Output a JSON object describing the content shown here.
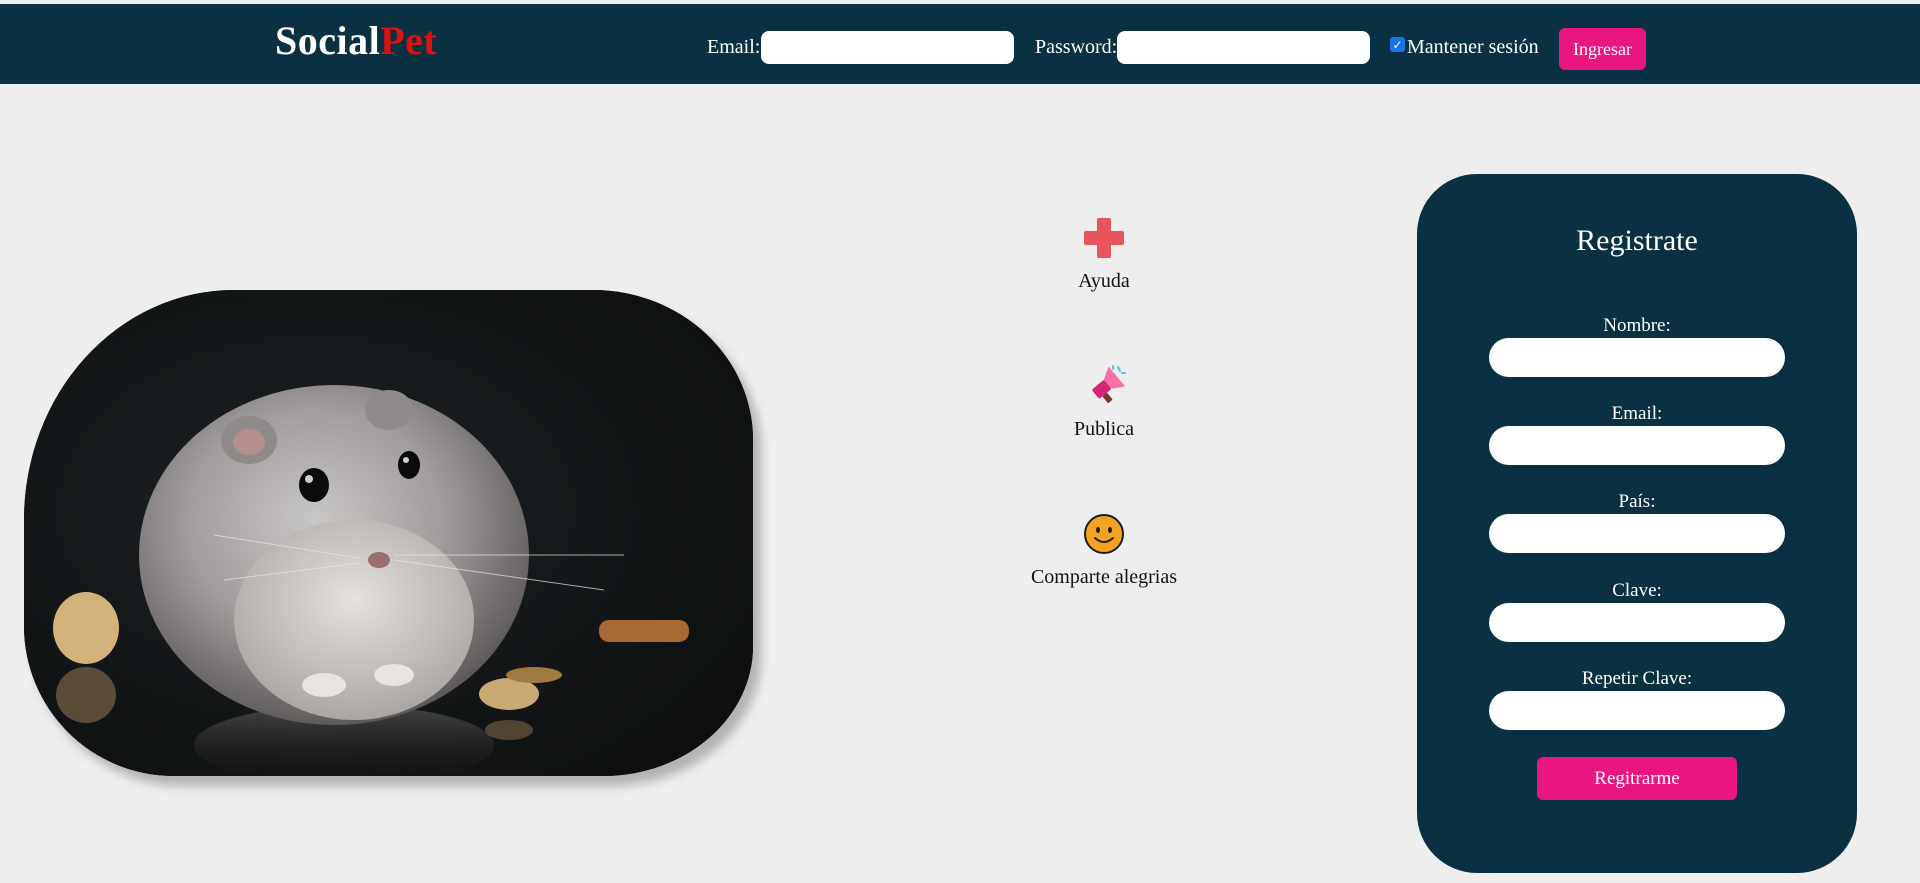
{
  "header": {
    "logo_part1": "Social",
    "logo_part2": "Pet",
    "email_label": "Email:",
    "email_value": "",
    "password_label": "Password:",
    "password_value": "",
    "keep_session_label": "Mantener sesión",
    "keep_session_checked": true,
    "login_button": "Ingresar"
  },
  "features": [
    {
      "icon": "red-cross-icon",
      "label": "Ayuda"
    },
    {
      "icon": "megaphone-icon",
      "label": "Publica"
    },
    {
      "icon": "smiley-icon",
      "label": "Comparte alegrias"
    }
  ],
  "register": {
    "title": "Registrate",
    "fields": [
      {
        "label": "Nombre:",
        "value": ""
      },
      {
        "label": "Email:",
        "value": ""
      },
      {
        "label": "País:",
        "value": ""
      },
      {
        "label": "Clave:",
        "value": ""
      },
      {
        "label": "Repetir Clave:",
        "value": ""
      }
    ],
    "submit_button": "Regitrarme"
  },
  "colors": {
    "header_bg": "#0a3142",
    "page_bg": "#eeeeee",
    "accent_pink": "#ea1680",
    "logo_red": "#e01010"
  }
}
